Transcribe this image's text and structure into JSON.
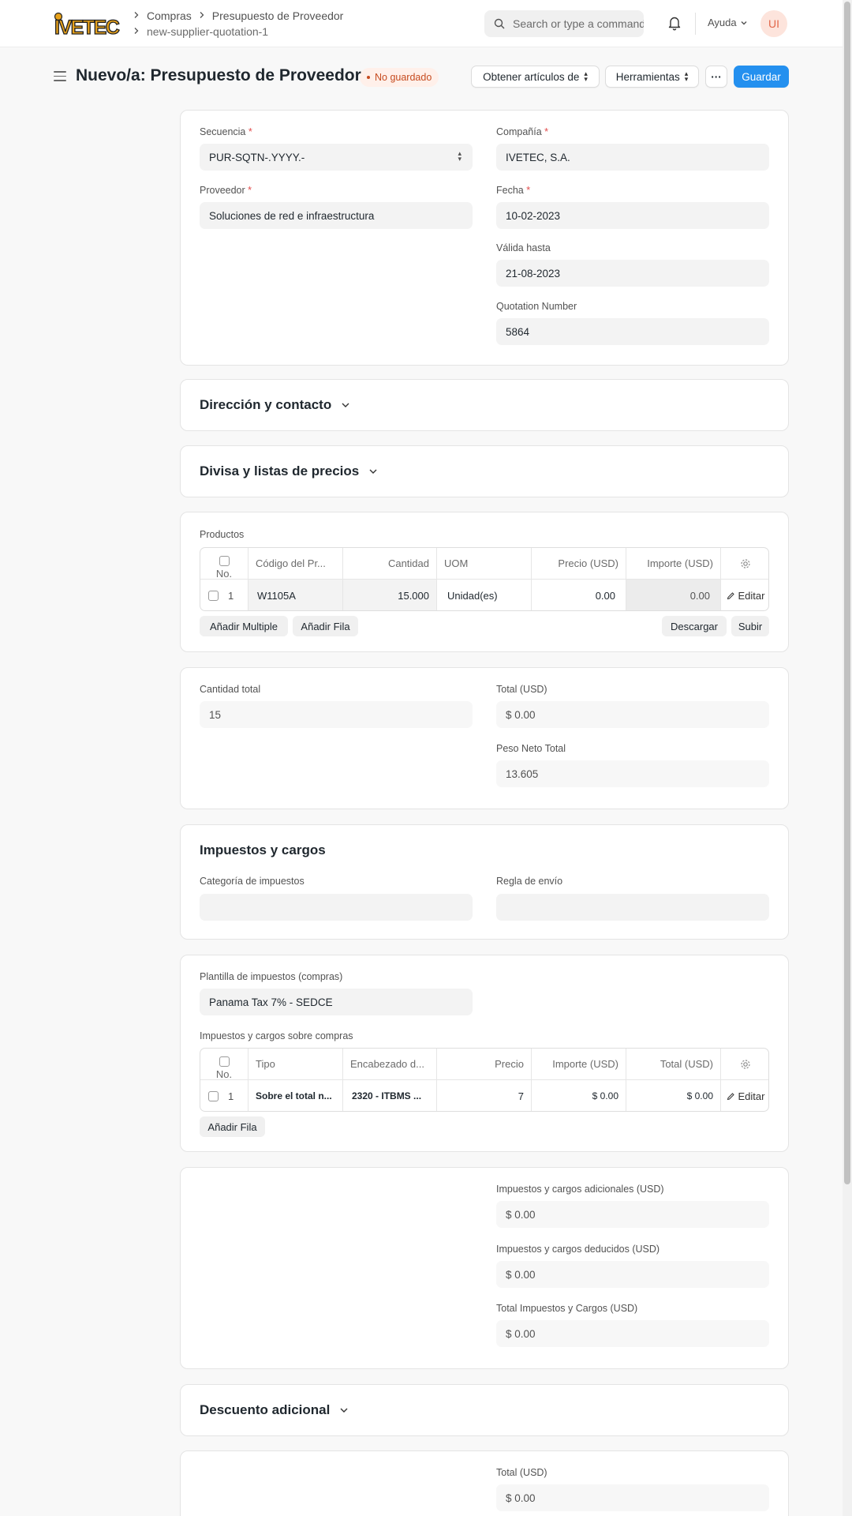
{
  "nav": {
    "breadcrumbs": [
      "Compras",
      "Presupuesto de Proveedor"
    ],
    "doc_name": "new-supplier-quotation-1",
    "search_placeholder": "Search or type a command",
    "help_label": "Ayuda",
    "avatar_initials": "UI",
    "logo_text": "IVETEC"
  },
  "page": {
    "title": "Nuevo/a: Presupuesto de Proveedor",
    "status": "No guardado",
    "btn_get_items": "Obtener artículos de",
    "btn_tools": "Herramientas",
    "btn_more": "···",
    "btn_save": "Guardar"
  },
  "header_fields": {
    "series_label": "Secuencia",
    "series_value": "PUR-SQTN-.YYYY.-",
    "company_label": "Compañía",
    "company_value": "IVETEC, S.A.",
    "supplier_label": "Proveedor",
    "supplier_value": "Soluciones de red e infraestructura",
    "date_label": "Fecha",
    "date_value": "10-02-2023",
    "valid_till_label": "Válida hasta",
    "valid_till_value": "21-08-2023",
    "quotation_number_label": "Quotation Number",
    "quotation_number_value": "5864"
  },
  "sections": {
    "address": "Dirección y contacto",
    "currency": "Divisa y listas de precios",
    "taxes": "Impuestos y cargos",
    "discount": "Descuento adicional"
  },
  "items": {
    "label": "Productos",
    "columns": [
      "No.",
      "Código del Pr...",
      "Cantidad",
      "UOM",
      "Precio (USD)",
      "Importe (USD)"
    ],
    "rows": [
      {
        "no": "1",
        "code": "W1105A",
        "qty": "15.000",
        "uom": "Unidad(es)",
        "rate": "0.00",
        "amount": "0.00",
        "edit": "Editar"
      }
    ],
    "btn_add_multiple": "Añadir Multiple",
    "btn_add_row": "Añadir Fila",
    "btn_download": "Descargar",
    "btn_upload": "Subir"
  },
  "totals": {
    "total_qty_label": "Cantidad total",
    "total_qty_value": "15",
    "total_label": "Total (USD)",
    "total_value": "$ 0.00",
    "net_weight_label": "Peso Neto Total",
    "net_weight_value": "13.605"
  },
  "tax_fields": {
    "category_label": "Categoría de impuestos",
    "category_value": "",
    "shipping_rule_label": "Regla de envío",
    "shipping_rule_value": ""
  },
  "tax_template": {
    "label": "Plantilla de impuestos (compras)",
    "value": "Panama Tax 7% - SEDCE",
    "table_label": "Impuestos y cargos sobre compras",
    "columns": [
      "No.",
      "Tipo",
      "Encabezado d...",
      "Precio",
      "Importe (USD)",
      "Total (USD)"
    ],
    "rows": [
      {
        "no": "1",
        "type": "Sobre el total n...",
        "head": "2320 - ITBMS ...",
        "rate": "7",
        "amount": "$ 0.00",
        "total": "$ 0.00",
        "edit": "Editar"
      }
    ],
    "btn_add_row": "Añadir Fila"
  },
  "tax_totals": {
    "added_label": "Impuestos y cargos adicionales (USD)",
    "added_value": "$ 0.00",
    "deducted_label": "Impuestos y cargos deducidos (USD)",
    "deducted_value": "$ 0.00",
    "total_label": "Total Impuestos y Cargos (USD)",
    "total_value": "$ 0.00"
  },
  "grand": {
    "total_label": "Total (USD)",
    "total_value": "$ 0.00"
  },
  "colors": {
    "primary": "#2490ef",
    "status_bg": "#fff0ea",
    "status_fg": "#c64b1f",
    "required": "#e24c4c"
  }
}
